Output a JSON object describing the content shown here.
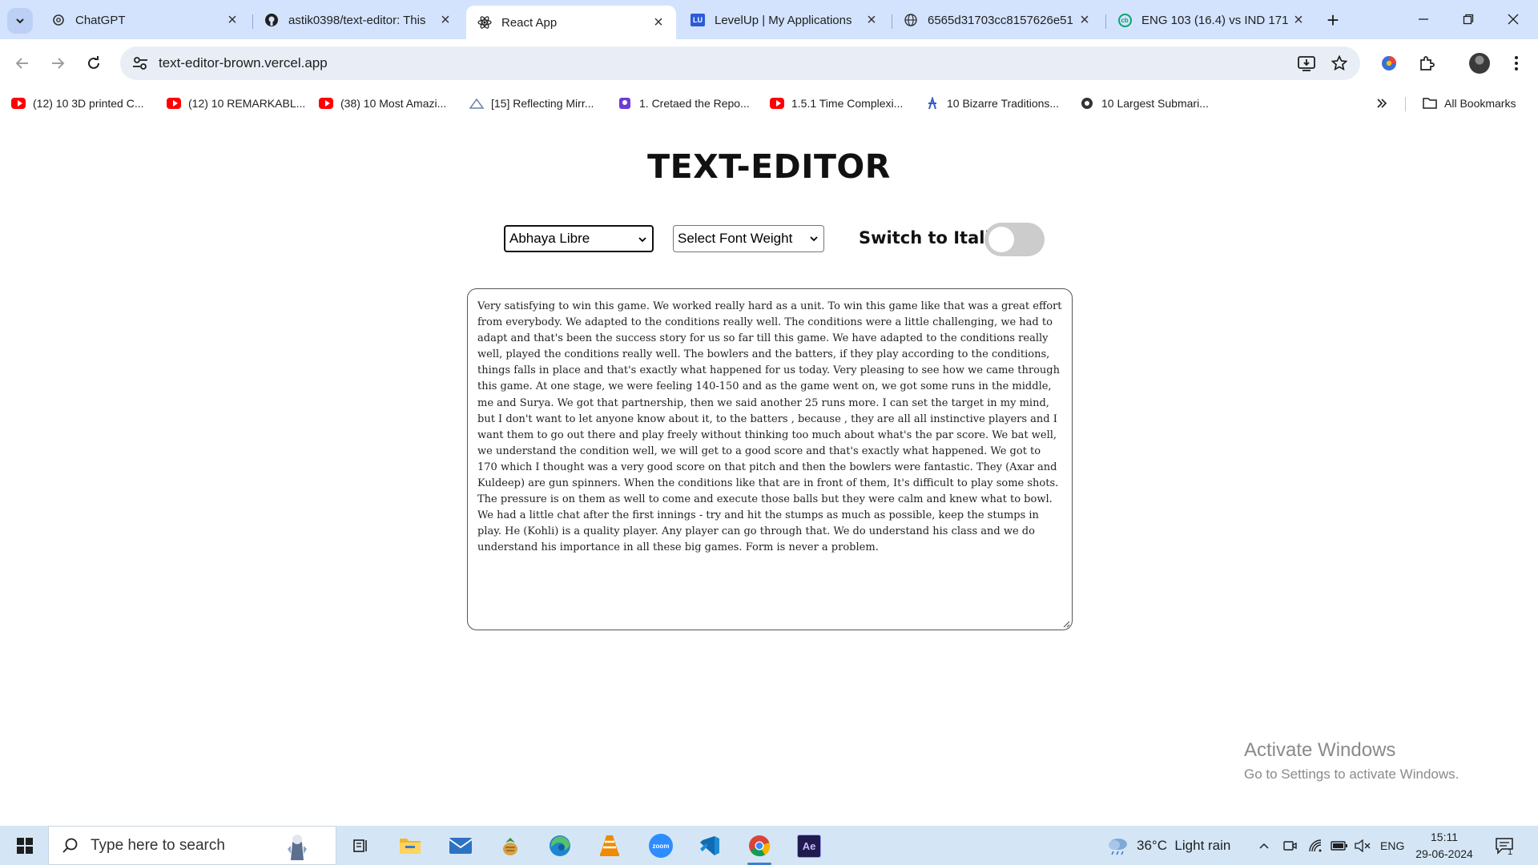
{
  "browser": {
    "tabs": [
      {
        "title": "ChatGPT",
        "icon": "openai-icon"
      },
      {
        "title": "astik0398/text-editor: This",
        "icon": "github-icon"
      },
      {
        "title": "React App",
        "icon": "react-icon"
      },
      {
        "title": "LevelUp | My Applications",
        "icon": "levelup-icon"
      },
      {
        "title": "6565d31703cc8157626e51",
        "icon": "globe-icon"
      },
      {
        "title": "ENG 103 (16.4) vs IND 171",
        "icon": "cricbuzz-icon"
      }
    ],
    "active_tab_index": 2,
    "levelup_badge": "LU",
    "cricbuzz_badge": "cb",
    "url": "text-editor-brown.vercel.app",
    "bookmarks": [
      {
        "label": "(12) 10 3D printed C...",
        "icon": "youtube-icon"
      },
      {
        "label": "(12) 10 REMARKABL...",
        "icon": "youtube-icon"
      },
      {
        "label": "(38) 10 Most Amazi...",
        "icon": "youtube-icon"
      },
      {
        "label": "[15] Reflecting Mirr...",
        "icon": "site-icon"
      },
      {
        "label": "1. Cretaed the Repo...",
        "icon": "site-icon"
      },
      {
        "label": "1.5.1 Time Complexi...",
        "icon": "youtube-icon"
      },
      {
        "label": "10 Bizarre Traditions...",
        "icon": "site-icon"
      },
      {
        "label": "10 Largest Submari...",
        "icon": "site-icon"
      }
    ],
    "all_bookmarks_label": "All Bookmarks",
    "colors": {
      "tabstrip": "#d3e3fd",
      "omnibox": "#e9eef6"
    }
  },
  "app": {
    "title": "TEXT-EDITOR",
    "font_family_select": "Abhaya Libre",
    "font_weight_select": "Select Font Weight",
    "italic_label": "Switch to Italic",
    "italic_enabled": false,
    "editor_text": "Very satisfying to win this game. We worked really hard as a unit. To win this game like that was a great effort from everybody. We adapted to the conditions really well. The conditions were a little challenging, we had to adapt and that's been the success story for us so far till this game. We have adapted to the conditions really well, played the conditions really well. The bowlers and the batters, if they play according to the conditions, things falls in place and that's exactly what happened for us today. Very pleasing to see how we came through this game. At one stage, we were feeling 140-150 and as the game went on, we got some runs in the middle, me and Surya. We got that partnership, then we said another 25 runs more. I can set the target in my mind, but I don't want to let anyone know about it, to the batters , because , they are all all instinctive players and I want them to go out there and play freely without thinking too much about what's the par score. We bat well, we understand the condition well, we will get to a good score and that's exactly what happened. We got to 170 which I thought was a very good score on that pitch and then the bowlers were fantastic. They (Axar and Kuldeep) are gun spinners. When the conditions like that are in front of them, It's difficult to play some shots. The pressure is on them as well to come and execute those balls but they were calm and knew what to bowl. We had a little chat after the first innings - try and hit the stumps as much as possible, keep the stumps in play. He (Kohli) is a quality player. Any player can go through that. We do understand his class and we do understand his importance in all these big games. Form is never a problem."
  },
  "watermark": {
    "line1": "Activate Windows",
    "line2": "Go to Settings to activate Windows."
  },
  "taskbar": {
    "search_placeholder": "Type here to search",
    "apps": [
      "task-view-icon",
      "file-explorer-icon",
      "mail-icon",
      "game-icon",
      "edge-icon",
      "vlc-icon",
      "zoom-icon",
      "vscode-icon",
      "chrome-icon",
      "after-effects-icon"
    ],
    "active_app": "chrome-icon",
    "zoom_label": "zoom",
    "after_effects_label": "Ae",
    "weather": "36°C  Light rain",
    "language": "ENG",
    "time": "15:11",
    "date": "29-06-2024",
    "notification_count": "1"
  }
}
